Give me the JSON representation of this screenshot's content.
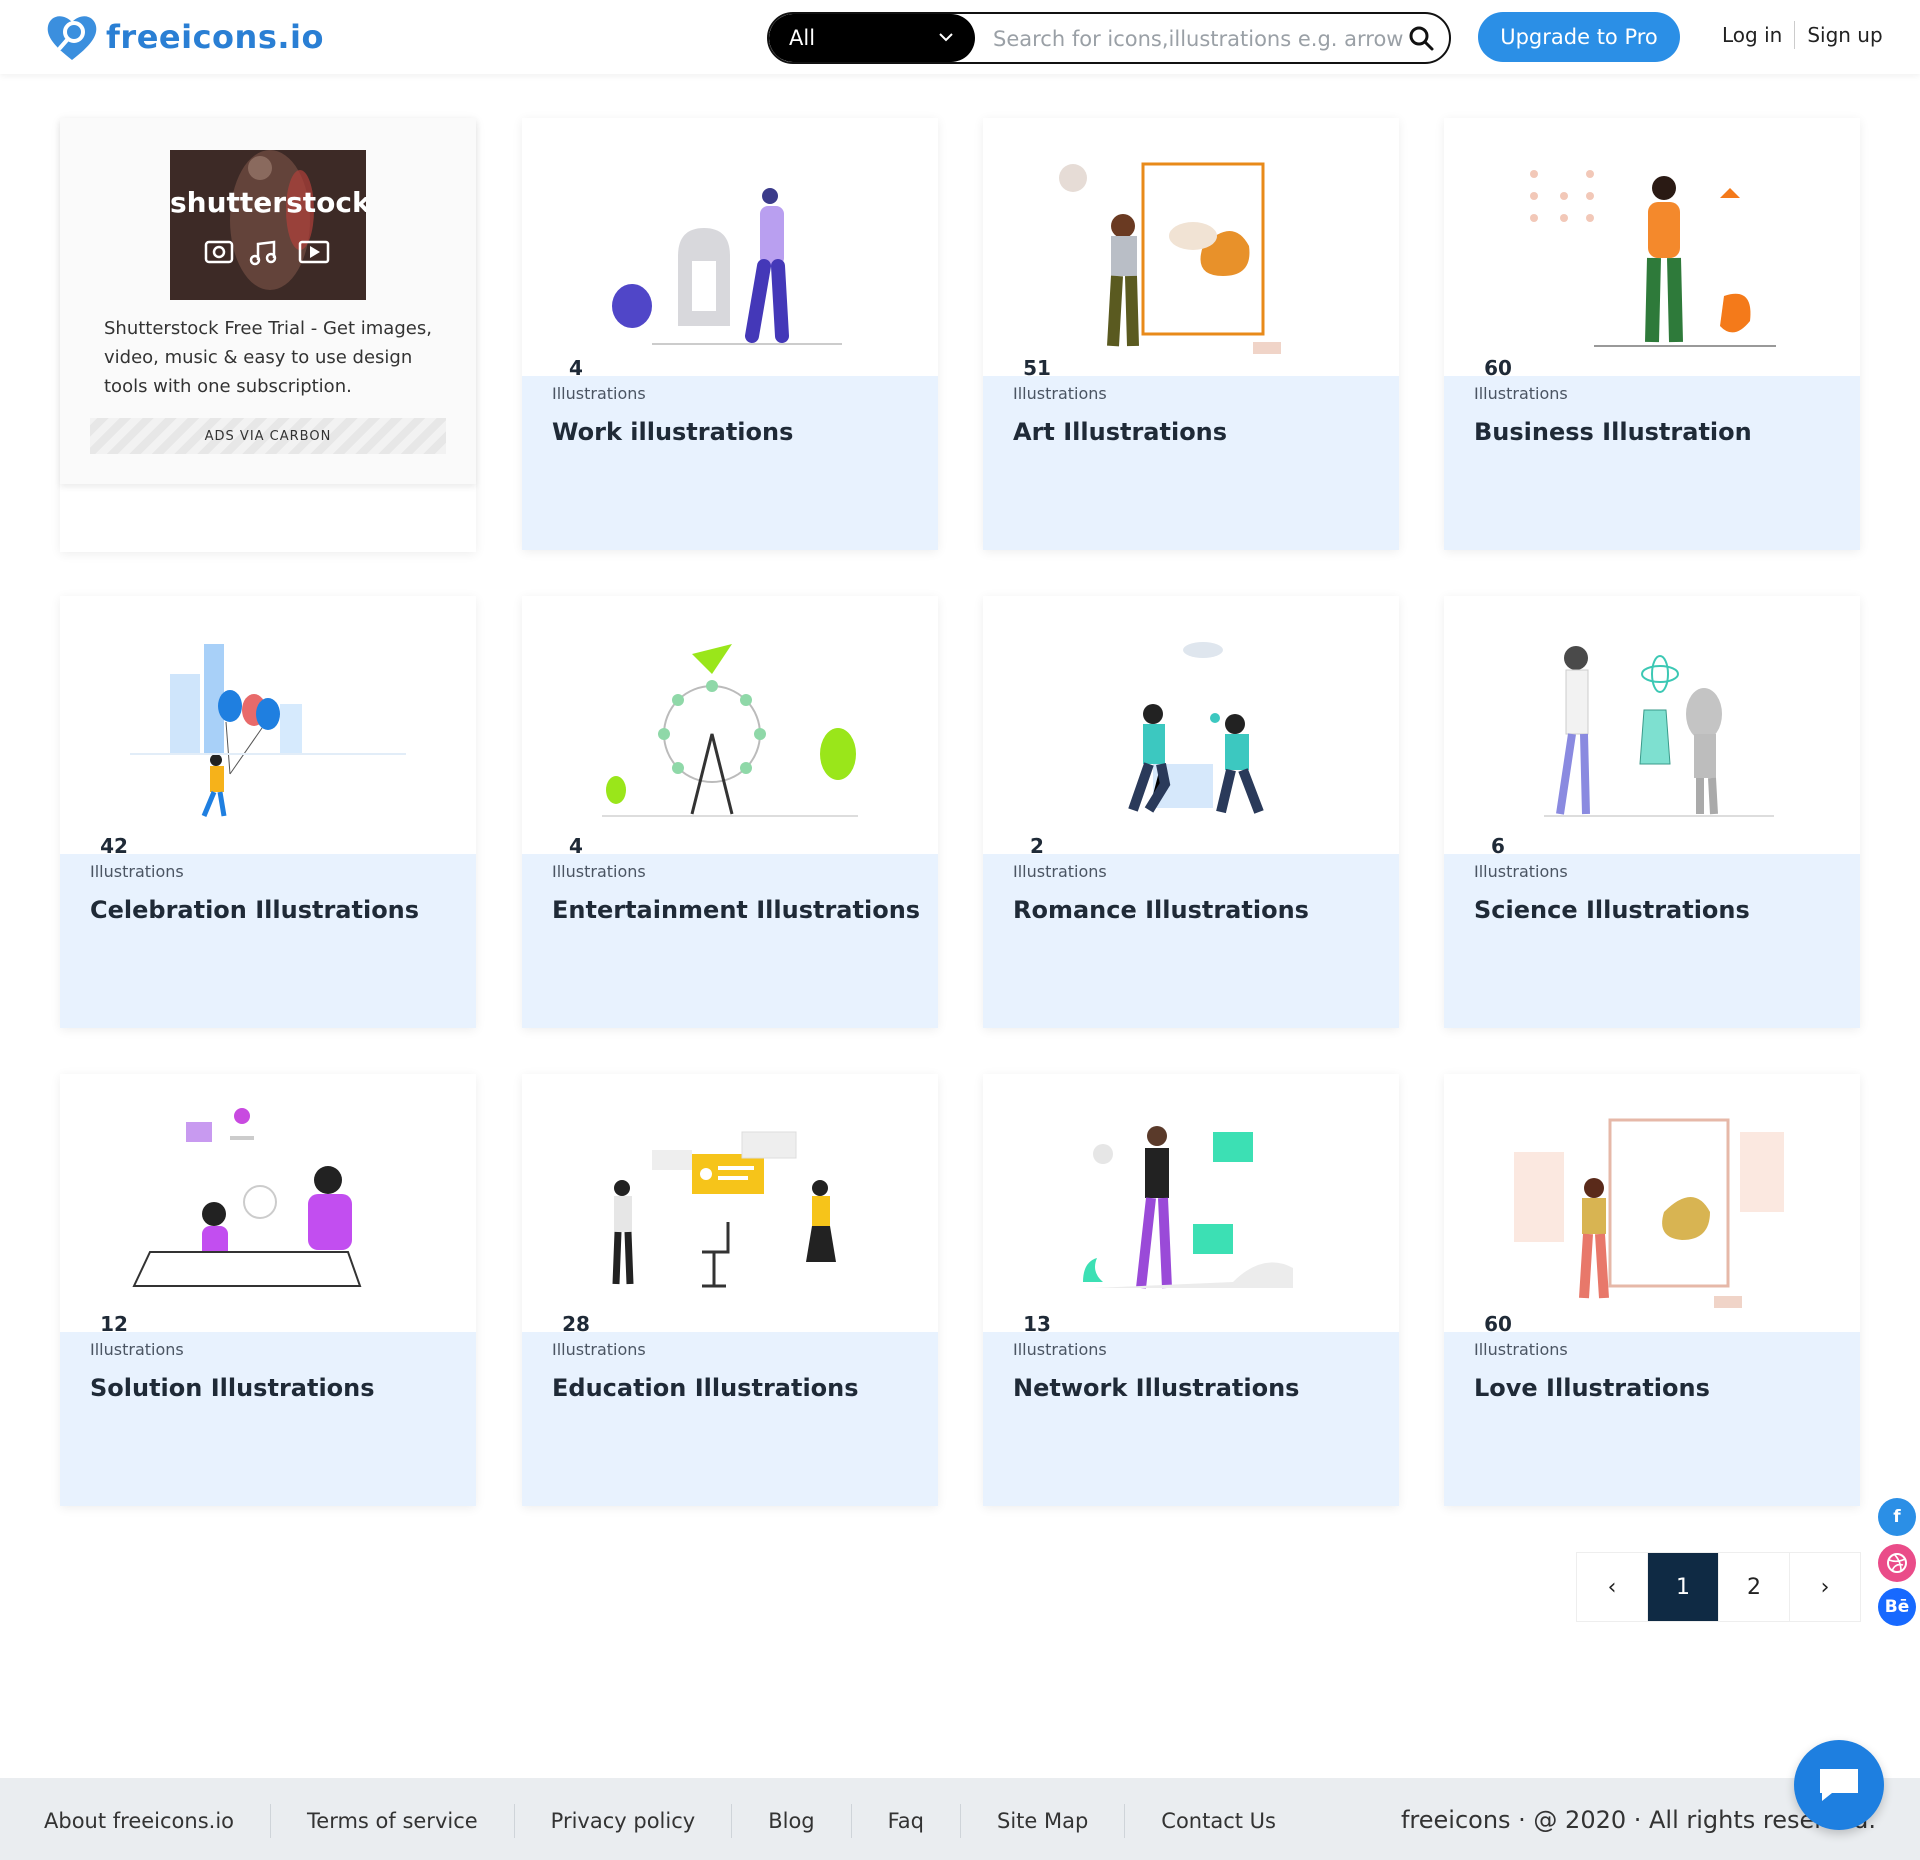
{
  "header": {
    "logo_text": "freeicons.io",
    "search_category": "All",
    "search_placeholder": "Search for icons,illustrations e.g. arrow, food",
    "upgrade_label": "Upgrade to Pro",
    "login_label": "Log in",
    "signup_label": "Sign up"
  },
  "ad": {
    "brand": "shutterstock",
    "text": "Shutterstock Free Trial - Get images, video, music & easy to use design tools with one subscription.",
    "via": "ADS VIA CARBON"
  },
  "count_label": "Illustrations",
  "cards": [
    {
      "count": "4",
      "title": "Work illustrations"
    },
    {
      "count": "51",
      "title": "Art Illustrations"
    },
    {
      "count": "60",
      "title": "Business Illustration"
    },
    {
      "count": "42",
      "title": "Celebration Illustrations"
    },
    {
      "count": "4",
      "title": "Entertainment Illustrations"
    },
    {
      "count": "2",
      "title": "Romance Illustrations"
    },
    {
      "count": "6",
      "title": "Science Illustrations"
    },
    {
      "count": "12",
      "title": "Solution Illustrations"
    },
    {
      "count": "28",
      "title": "Education Illustrations"
    },
    {
      "count": "13",
      "title": "Network Illustrations"
    },
    {
      "count": "60",
      "title": "Love Illustrations"
    }
  ],
  "pagination": {
    "prev": "‹",
    "pages": [
      "1",
      "2"
    ],
    "next": "›",
    "active": "1"
  },
  "social": [
    "f",
    "Bē"
  ],
  "footer": {
    "links": [
      "About freeicons.io",
      "Terms of service",
      "Privacy policy",
      "Blog",
      "Faq",
      "Site Map",
      "Contact Us"
    ],
    "copyright": "freeicons · @ 2020 · All rights reserved."
  },
  "colors": {
    "brand": "#2a7fd4",
    "accent": "#2b8fe6",
    "card_info_bg": "#e8f2fe",
    "pager_active": "#0f2a44"
  }
}
